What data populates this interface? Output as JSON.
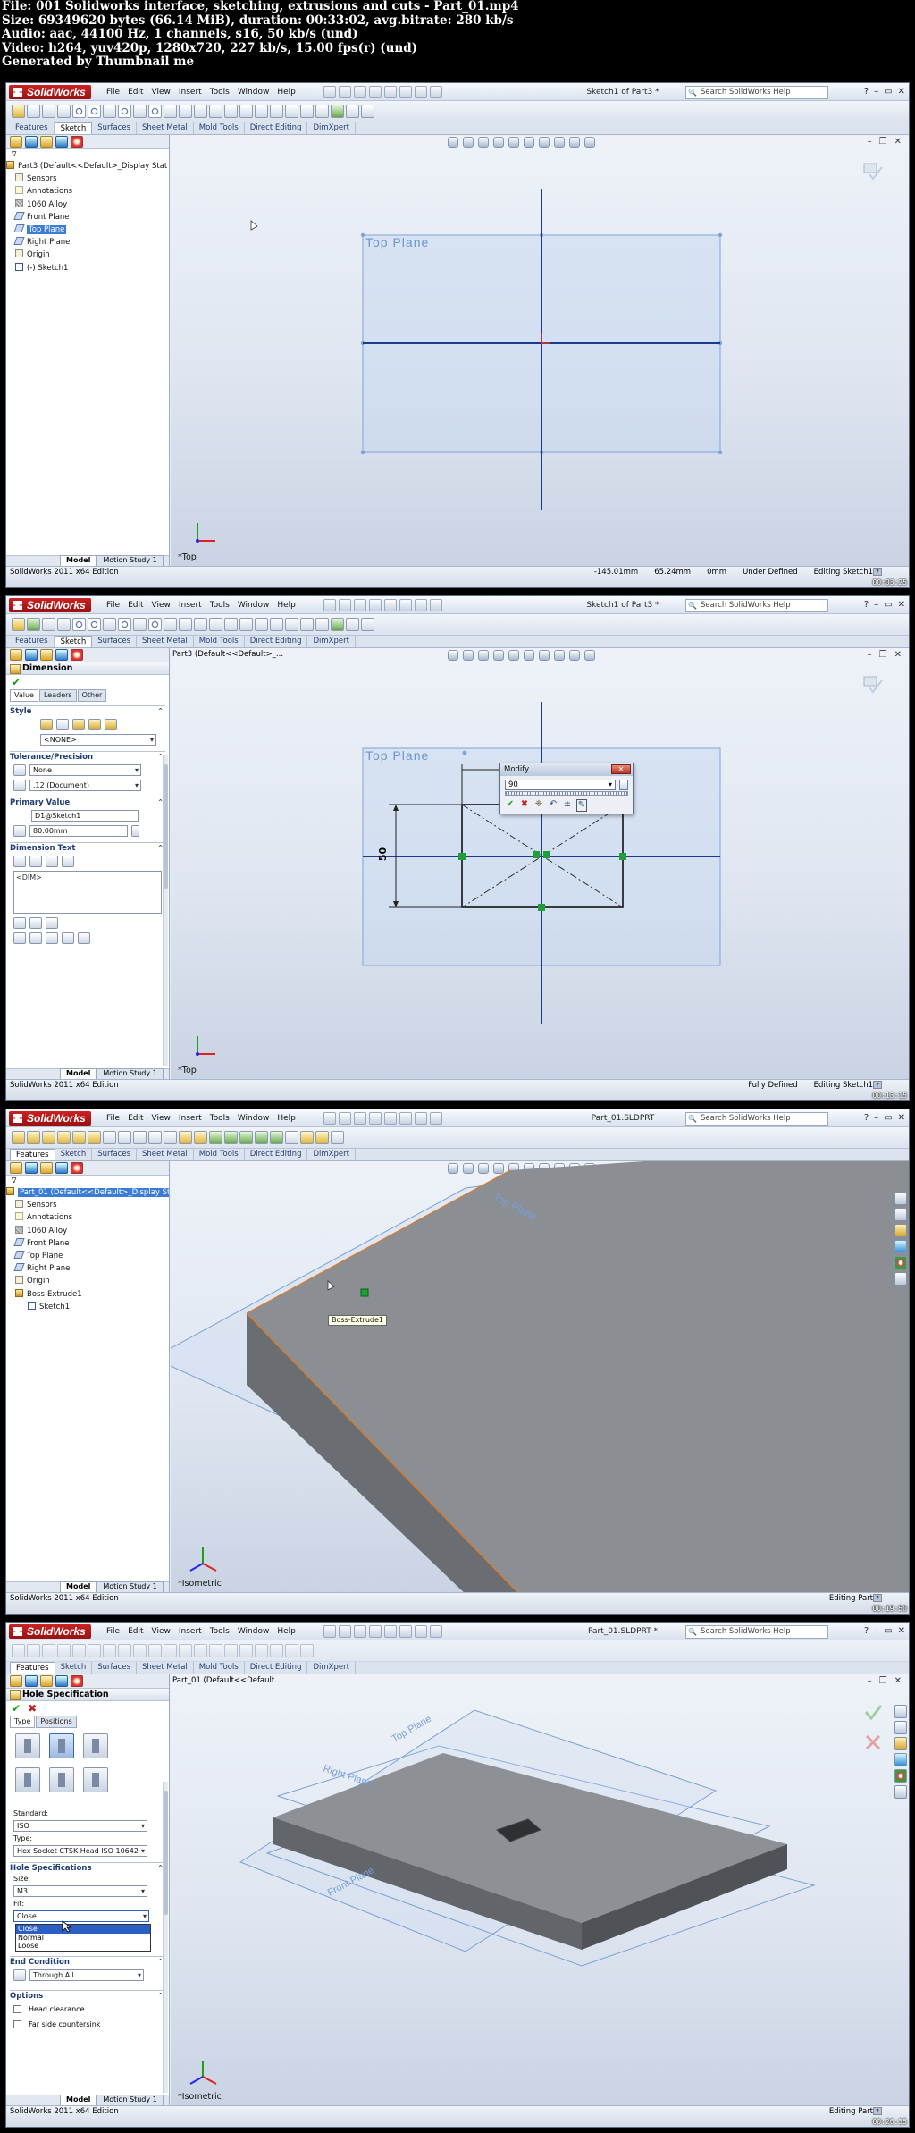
{
  "info": {
    "file": "File: 001 Solidworks interface, sketching, extrusions and cuts - Part_01.mp4",
    "size": "Size: 69349620 bytes (66.14 MiB), duration: 00:33:02, avg.bitrate: 280 kb/s",
    "audio": "Audio: aac, 44100 Hz, 1 channels, s16, 50 kb/s (und)",
    "video": "Video: h264, yuv420p, 1280x720, 227 kb/s, 15.00 fps(r) (und)",
    "generated": "Generated by Thumbnail me"
  },
  "app": {
    "logo": "SolidWorks",
    "menu": [
      "File",
      "Edit",
      "View",
      "Insert",
      "Tools",
      "Window",
      "Help"
    ],
    "search_placeholder": "Search SolidWorks Help",
    "edition": "SolidWorks 2011 x64 Edition",
    "tabs": [
      "Features",
      "Sketch",
      "Surfaces",
      "Sheet Metal",
      "Mold Tools",
      "Direct Editing",
      "DimXpert"
    ],
    "model_tabs": [
      "Model",
      "Motion Study 1"
    ],
    "window_buttons": [
      "?",
      "–",
      "▭",
      "✕"
    ]
  },
  "frame1": {
    "window_title": "Sketch1 of Part3 *",
    "active_tab": "Sketch",
    "tree": [
      {
        "label": "Part3  (Default<<Default>_Display Stat",
        "icon": "part"
      },
      {
        "label": "Sensors",
        "icon": "sensor"
      },
      {
        "label": "Annotations",
        "icon": "ann"
      },
      {
        "label": "1060 Alloy",
        "icon": "mat"
      },
      {
        "label": "Front Plane",
        "icon": "plane"
      },
      {
        "label": "Top Plane",
        "icon": "plane",
        "selected": true
      },
      {
        "label": "Right Plane",
        "icon": "plane"
      },
      {
        "label": "Origin",
        "icon": "origin"
      },
      {
        "label": "(-) Sketch1",
        "icon": "sk"
      }
    ],
    "plane_label": "Top Plane",
    "view_label": "*Top",
    "status": [
      "-145.01mm",
      "65.24mm",
      "0mm",
      "Under Defined",
      "Editing Sketch1"
    ],
    "timestamp": "00:03:25"
  },
  "frame2": {
    "window_title": "Sketch1 of Part3 *",
    "active_tab": "Sketch",
    "breadcrumb": "Part3  (Default<<Default>_...",
    "pm_title": "Dimension",
    "pm_tabs": [
      "Value",
      "Leaders",
      "Other"
    ],
    "style_label": "Style",
    "style_value": "<NONE>",
    "tolerance_label": "Tolerance/Precision",
    "tolerance_value": "None",
    "precision_value": ".12 (Document)",
    "primary_label": "Primary Value",
    "primary_name": "D1@Sketch1",
    "primary_value": "80.00mm",
    "dimtext_label": "Dimension Text",
    "dimtext_value": "<DIM>",
    "plane_label": "Top Plane",
    "dim_label": "50",
    "modify_title": "Modify",
    "modify_value": "90",
    "view_label": "*Top",
    "status": [
      "Fully Defined",
      "Editing Sketch1"
    ],
    "timestamp": "00:13:15"
  },
  "frame3": {
    "window_title": "Part_01.SLDPRT",
    "active_tab": "Features",
    "tree": [
      {
        "label": "Part_01  (Default<<Default>_Display St",
        "icon": "part",
        "selected": true
      },
      {
        "label": "Sensors",
        "icon": "sensor"
      },
      {
        "label": "Annotations",
        "icon": "ann"
      },
      {
        "label": "1060 Alloy",
        "icon": "mat"
      },
      {
        "label": "Front Plane",
        "icon": "plane"
      },
      {
        "label": "Top Plane",
        "icon": "plane"
      },
      {
        "label": "Right Plane",
        "icon": "plane"
      },
      {
        "label": "Origin",
        "icon": "origin"
      },
      {
        "label": "Boss-Extrude1",
        "icon": "part"
      },
      {
        "label": "Sketch1",
        "icon": "sk"
      }
    ],
    "tooltip": "Boss-Extrude1",
    "view_label": "*Isometric",
    "status": [
      "Editing Part"
    ],
    "timestamp": "00:19:50"
  },
  "frame4": {
    "window_title": "Part_01.SLDPRT *",
    "active_tab": "Features",
    "breadcrumb": "Part_01  (Default<<Default...",
    "pm_title": "Hole Specification",
    "pm_tabs": [
      "Type",
      "Positions"
    ],
    "standard_label": "Standard:",
    "standard_value": "ISO",
    "type_label": "Type:",
    "type_value": "Hex Socket CTSK Head ISO 10642",
    "hole_spec_label": "Hole Specifications",
    "size_label": "Size:",
    "size_value": "M3",
    "fit_label": "Fit:",
    "fit_value": "Close",
    "fit_options": [
      "Close",
      "Normal",
      "Loose"
    ],
    "end_label": "End Condition",
    "end_value": "Through All",
    "options_label": "Options",
    "opt_head": "Head clearance",
    "opt_far": "Far side countersink",
    "view_label": "*Isometric",
    "status": [
      "Editing Part"
    ],
    "timestamp": "00:26:35"
  }
}
